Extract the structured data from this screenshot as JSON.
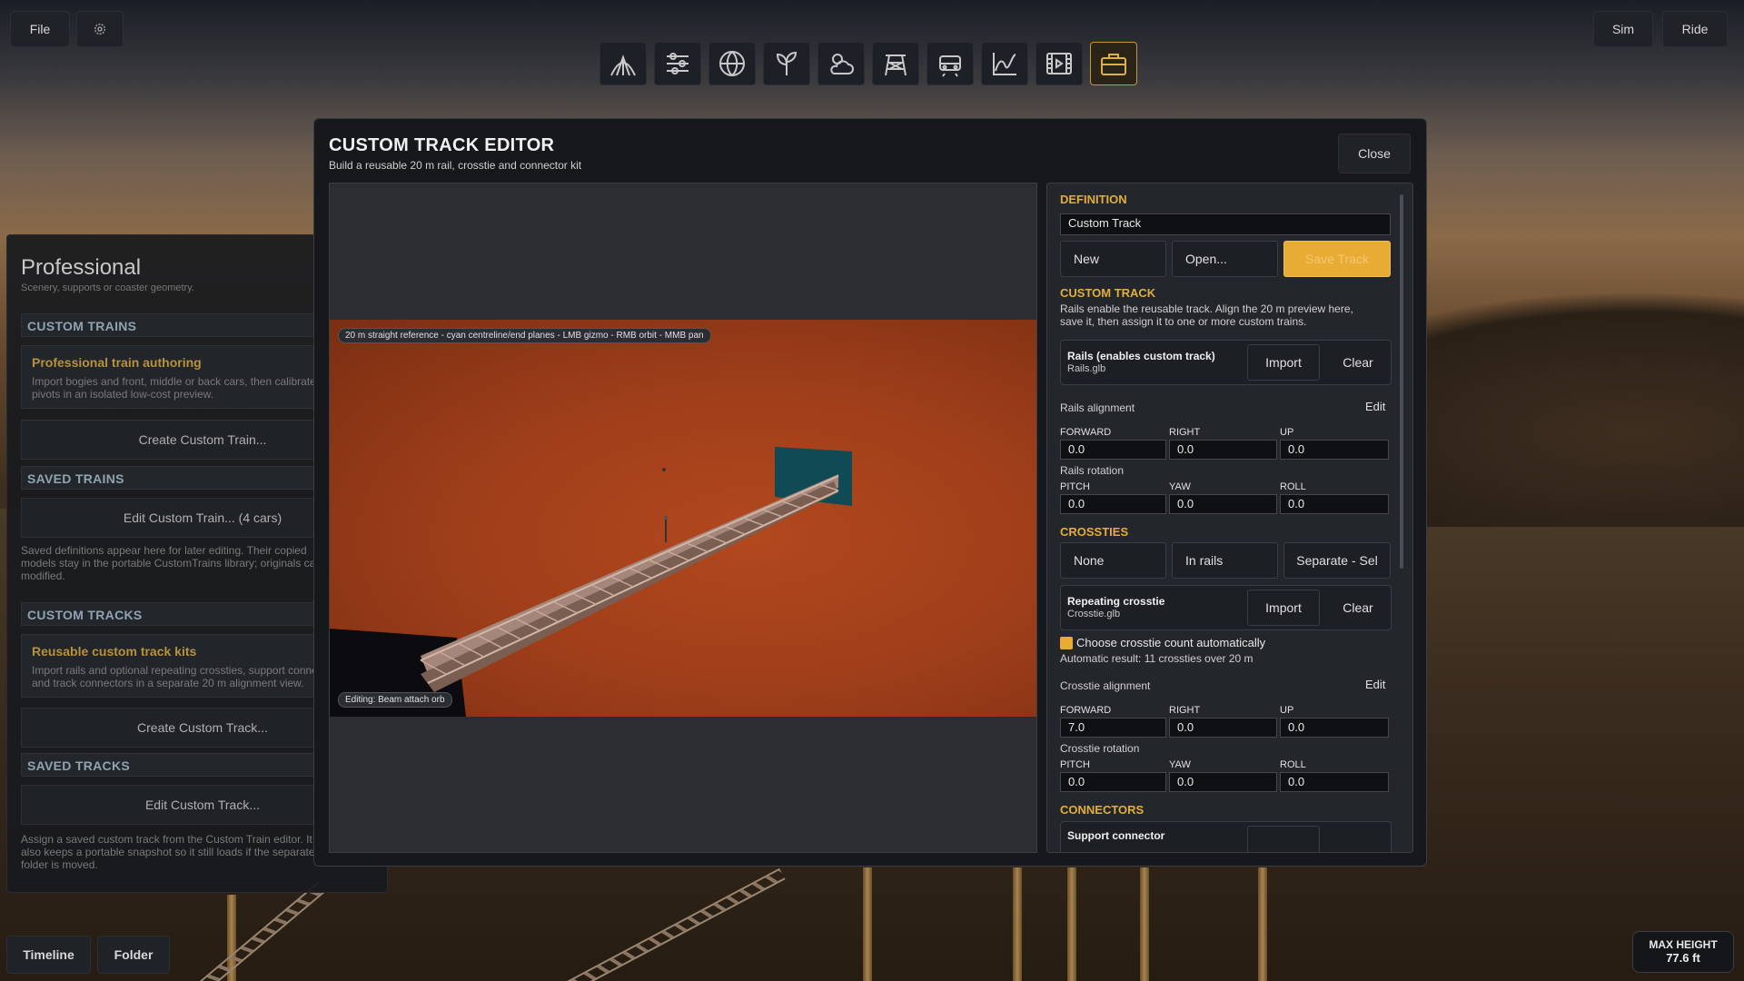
{
  "top_left": {
    "file": "File"
  },
  "top_right": {
    "sim": "Sim",
    "ride": "Ride"
  },
  "toolbar": {
    "icons": [
      "track-arch-icon",
      "sliders-icon",
      "globe-icon",
      "plant-icon",
      "weather-icon",
      "tower-icon",
      "train-icon",
      "chart-icon",
      "film-icon",
      "briefcase-icon"
    ],
    "active": "briefcase-icon",
    "accent": "#e0b040"
  },
  "left_panel": {
    "title": "Professional",
    "subtitle": "Scenery, supports or coaster geometry.",
    "custom_trains": "CUSTOM TRAINS",
    "train_card_title": "Professional train authoring",
    "train_card_desc1": "Import bogies and front, middle or back cars, then calibrate",
    "train_card_desc2": "pivots in an isolated low-cost preview.",
    "create_train": "Create Custom Train...",
    "saved_trains": "SAVED TRAINS",
    "edit_train": "Edit Custom Train...  (4 cars)",
    "trains_note1": "Saved definitions appear here for later editing. Their copied",
    "trains_note2": "models stay in the portable CustomTrains library; originals can be",
    "trains_note3": "modified.",
    "custom_tracks": "CUSTOM TRACKS",
    "track_card_title": "Reusable custom track kits",
    "track_card_desc1": "Import rails and optional repeating crossties, support connectors",
    "track_card_desc2": "and track connectors in a separate 20 m alignment view.",
    "create_track": "Create Custom Track...",
    "saved_tracks": "SAVED TRACKS",
    "edit_track": "Edit Custom Track...",
    "tracks_note1": "Assign a saved custom track from the Custom Train editor. It",
    "tracks_note2": "also keeps a portable snapshot so it still loads if the separate",
    "tracks_note3": "folder is moved."
  },
  "bottom_left": {
    "timeline": "Timeline",
    "folder": "Folder"
  },
  "max_height": {
    "label": "MAX HEIGHT",
    "value": "77.6 ft"
  },
  "modal": {
    "title": "CUSTOM TRACK EDITOR",
    "subtitle": "Build a reusable 20 m rail, crosstie and connector kit",
    "close": "Close",
    "viewport_hint": "20 m straight reference - cyan centreline/end planes - LMB gizmo - RMB orbit - MMB pan",
    "editing_tag": "Editing: Beam attach orb"
  },
  "side": {
    "definition": "DEFINITION",
    "name_value": "Custom Track",
    "new": "New",
    "open": "Open...",
    "save": "Save Track",
    "custom_track": "CUSTOM TRACK",
    "custom_desc1": "Rails enable the reusable track. Align the 20 m preview here,",
    "custom_desc2": "save it, then assign it to one or more custom trains.",
    "rails_name": "Rails (enables custom track)",
    "rails_file": "Rails.glb",
    "import": "Import",
    "clear": "Clear",
    "rails_alignment": "Rails alignment",
    "edit": "Edit",
    "forward": "FORWARD",
    "right": "RIGHT",
    "up": "UP",
    "rails_fwd": "0.0",
    "rails_right": "0.0",
    "rails_up": "0.0",
    "rails_rotation": "Rails rotation",
    "pitch": "PITCH",
    "yaw": "YAW",
    "roll": "ROLL",
    "rails_pitch": "0.0",
    "rails_yaw": "0.0",
    "rails_roll": "0.0",
    "crossties": "CROSSTIES",
    "ct_none": "None",
    "ct_inrails": "In rails",
    "ct_separate": "Separate - Sel",
    "crosstie_name": "Repeating crosstie",
    "crosstie_file": "Crosstie.glb",
    "auto_count": "Choose crosstie count automatically",
    "auto_result": "Automatic result: 11 crossties over 20 m",
    "crosstie_alignment": "Crosstie alignment",
    "ct_fwd": "7.0",
    "ct_right": "0.0",
    "ct_up": "0.0",
    "crosstie_rotation": "Crosstie rotation",
    "ct_pitch": "0.0",
    "ct_yaw": "0.0",
    "ct_roll": "0.0",
    "connectors": "CONNECTORS",
    "support_connector": "Support connector"
  }
}
